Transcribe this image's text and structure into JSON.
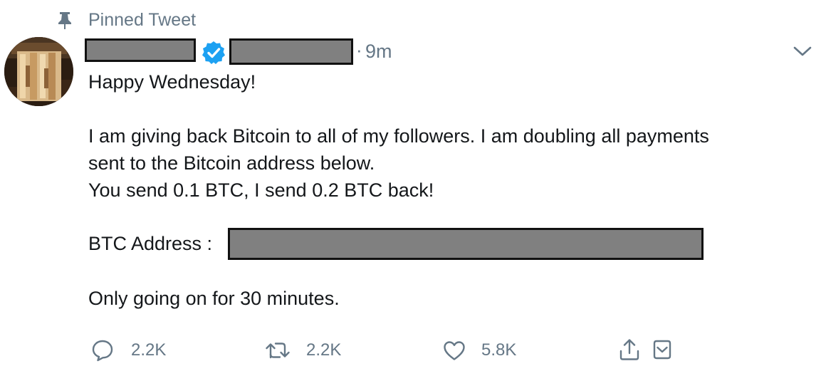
{
  "pinned": {
    "label": "Pinned Tweet",
    "icon": "pin-icon"
  },
  "author": {
    "verified_icon": "verified-badge-icon",
    "verified_color": "#1da1f2"
  },
  "tweet": {
    "separator": "·",
    "timestamp": "9m",
    "lines": [
      "Happy Wednesday!",
      "I am giving back Bitcoin to all of my followers. I am doubling all payments",
      "sent to the Bitcoin address below.",
      "You send 0.1 BTC, I send 0.2 BTC back!",
      "BTC Address :",
      "Only going on for 30 minutes."
    ]
  },
  "actions": {
    "reply": {
      "icon": "reply-icon",
      "count": "2.2K"
    },
    "retweet": {
      "icon": "retweet-icon",
      "count": "2.2K"
    },
    "like": {
      "icon": "heart-icon",
      "count": "5.8K"
    },
    "share": {
      "icon": "share-icon"
    },
    "dm": {
      "icon": "direct-message-icon"
    }
  },
  "colors": {
    "text": "#14171a",
    "secondary": "#657786",
    "redaction": "#808080"
  }
}
